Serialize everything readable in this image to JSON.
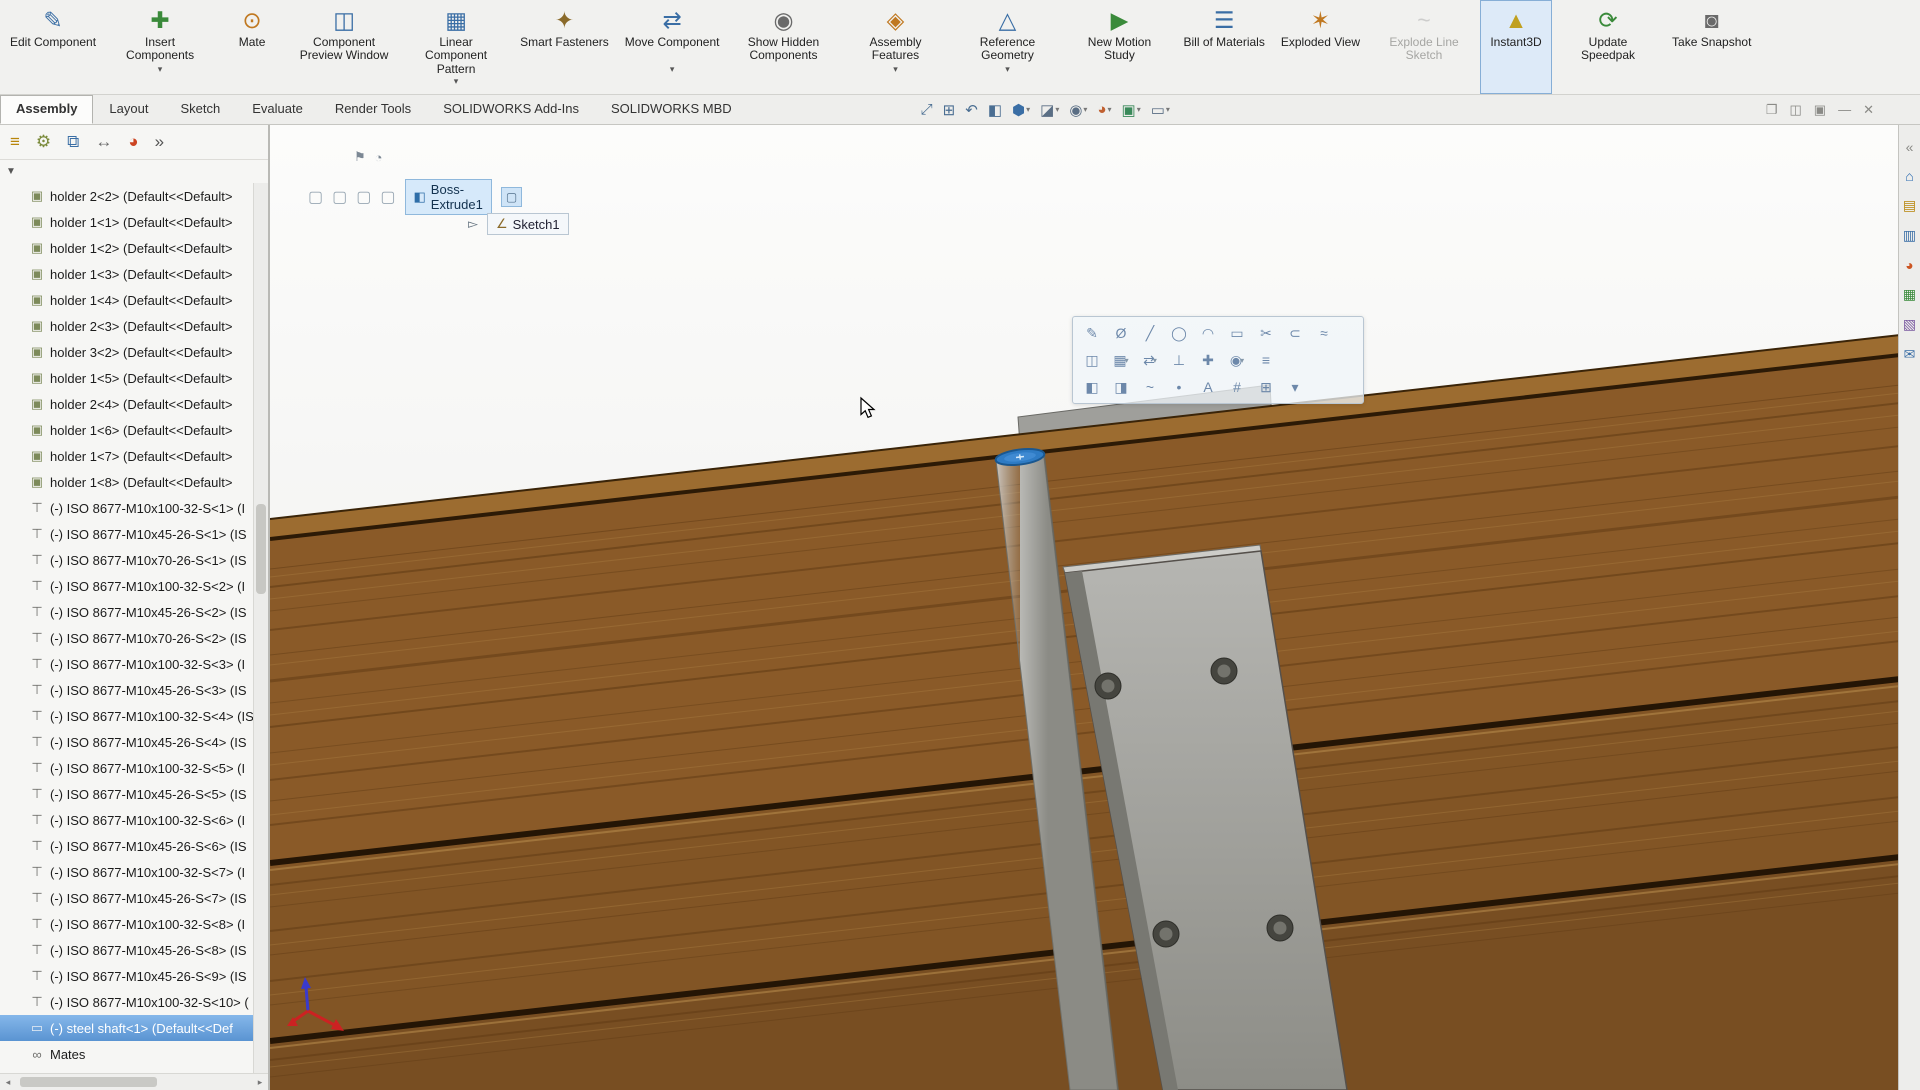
{
  "ribbon": {
    "buttons": [
      {
        "name": "edit-component-button",
        "label": "Edit Component",
        "glyph": "✎",
        "color": "#3a6ea5",
        "dropdown": false,
        "state": ""
      },
      {
        "name": "insert-components-button",
        "label": "Insert Components",
        "glyph": "✚",
        "color": "#3a8a3a",
        "dropdown": true,
        "state": ""
      },
      {
        "name": "mate-button",
        "label": "Mate",
        "glyph": "⊙",
        "color": "#c07820",
        "dropdown": false,
        "state": ""
      },
      {
        "name": "component-preview-window-button",
        "label": "Component Preview Window",
        "glyph": "◫",
        "color": "#3a6ea5",
        "dropdown": false,
        "state": ""
      },
      {
        "name": "linear-component-pattern-button",
        "label": "Linear Component Pattern",
        "glyph": "▦",
        "color": "#3a6ea5",
        "dropdown": true,
        "state": ""
      },
      {
        "name": "smart-fasteners-button",
        "label": "Smart Fasteners",
        "glyph": "✦",
        "color": "#8a6a2a",
        "dropdown": false,
        "state": ""
      },
      {
        "name": "move-component-button",
        "label": "Move Component",
        "glyph": "⇄",
        "color": "#3a6ea5",
        "dropdown": true,
        "state": ""
      },
      {
        "name": "show-hidden-components-button",
        "label": "Show Hidden Components",
        "glyph": "◉",
        "color": "#6a6a6a",
        "dropdown": false,
        "state": ""
      },
      {
        "name": "assembly-features-button",
        "label": "Assembly Features",
        "glyph": "◈",
        "color": "#c07820",
        "dropdown": true,
        "state": ""
      },
      {
        "name": "reference-geometry-button",
        "label": "Reference Geometry",
        "glyph": "△",
        "color": "#3a6ea5",
        "dropdown": true,
        "state": ""
      },
      {
        "name": "new-motion-study-button",
        "label": "New Motion Study",
        "glyph": "▶",
        "color": "#3a8a3a",
        "dropdown": false,
        "state": ""
      },
      {
        "name": "bill-of-materials-button",
        "label": "Bill of Materials",
        "glyph": "☰",
        "color": "#3a6ea5",
        "dropdown": false,
        "state": ""
      },
      {
        "name": "exploded-view-button",
        "label": "Exploded View",
        "glyph": "✶",
        "color": "#c07820",
        "dropdown": false,
        "state": ""
      },
      {
        "name": "explode-line-sketch-button",
        "label": "Explode Line Sketch",
        "glyph": "~",
        "color": "#9a9a9a",
        "dropdown": false,
        "state": "disabled"
      },
      {
        "name": "instant3d-button",
        "label": "Instant3D",
        "glyph": "▲",
        "color": "#c0a020",
        "dropdown": false,
        "state": "active"
      },
      {
        "name": "update-speedpak-button",
        "label": "Update Speedpak",
        "glyph": "⟳",
        "color": "#3a8a3a",
        "dropdown": false,
        "state": ""
      },
      {
        "name": "take-snapshot-button",
        "label": "Take Snapshot",
        "glyph": "◙",
        "color": "#6a6a6a",
        "dropdown": false,
        "state": ""
      }
    ]
  },
  "tabs": {
    "items": [
      {
        "label": "Assembly",
        "state": "active"
      },
      {
        "label": "Layout",
        "state": ""
      },
      {
        "label": "Sketch",
        "state": ""
      },
      {
        "label": "Evaluate",
        "state": ""
      },
      {
        "label": "Render Tools",
        "state": ""
      },
      {
        "label": "SOLIDWORKS Add-Ins",
        "state": ""
      },
      {
        "label": "SOLIDWORKS MBD",
        "state": ""
      }
    ]
  },
  "headsup": {
    "icons": [
      {
        "name": "zoom-to-fit-icon",
        "glyph": "⤢",
        "caret": false,
        "color": "#4a6e92"
      },
      {
        "name": "zoom-to-area-icon",
        "glyph": "⊞",
        "caret": false,
        "color": "#4a6e92"
      },
      {
        "name": "previous-view-icon",
        "glyph": "↶",
        "caret": false,
        "color": "#4a6e92"
      },
      {
        "name": "section-view-icon",
        "glyph": "◧",
        "caret": false,
        "color": "#4a6e92"
      },
      {
        "name": "view-orientation-icon",
        "glyph": "⬢",
        "caret": true,
        "color": "#3a6ea5"
      },
      {
        "name": "display-style-icon",
        "glyph": "◪",
        "caret": true,
        "color": "#5a6e84"
      },
      {
        "name": "hide-show-items-icon",
        "glyph": "◉",
        "caret": true,
        "color": "#5a6e84"
      },
      {
        "name": "edit-appearance-icon",
        "glyph": "◕",
        "caret": true,
        "color": "#c06030"
      },
      {
        "name": "apply-scene-icon",
        "glyph": "▣",
        "caret": true,
        "color": "#3a8a5a"
      },
      {
        "name": "view-settings-icon",
        "glyph": "▭",
        "caret": true,
        "color": "#5a6e84"
      }
    ]
  },
  "window_controls": {
    "icons": [
      {
        "name": "window-cascade-icon",
        "glyph": "❐"
      },
      {
        "name": "window-tile-icon",
        "glyph": "◫"
      },
      {
        "name": "window-restore-icon",
        "glyph": "▣"
      },
      {
        "name": "window-minimize-icon",
        "glyph": "—"
      },
      {
        "name": "window-close-icon",
        "glyph": "✕"
      }
    ]
  },
  "taskpane": {
    "icons": [
      {
        "name": "taskpane-collapse-icon",
        "glyph": "«",
        "color": "#8a8a86"
      },
      {
        "name": "home-icon",
        "glyph": "⌂",
        "color": "#2a6ab0"
      },
      {
        "name": "design-library-icon",
        "glyph": "▤",
        "color": "#b8860b"
      },
      {
        "name": "file-explorer-icon",
        "glyph": "▥",
        "color": "#3a6ea5"
      },
      {
        "name": "appearances-icon",
        "glyph": "◕",
        "color": "#cc5522"
      },
      {
        "name": "scenes-icon",
        "glyph": "▦",
        "color": "#3a8a3a"
      },
      {
        "name": "custom-properties-icon",
        "glyph": "▧",
        "color": "#7a5aa0"
      },
      {
        "name": "forum-icon",
        "glyph": "✉",
        "color": "#3a6ea5"
      }
    ]
  },
  "panel": {
    "tab_icons": [
      {
        "name": "featuremanager-tree-icon",
        "glyph": "≡",
        "color": "#b8860b"
      },
      {
        "name": "propertymanager-icon",
        "glyph": "⚙",
        "color": "#7a8a3a"
      },
      {
        "name": "configurationmanager-icon",
        "glyph": "⧉",
        "color": "#3a6ea5"
      },
      {
        "name": "dimxpertmanager-icon",
        "glyph": "↔",
        "color": "#6a6a6a"
      },
      {
        "name": "displaymanager-icon",
        "glyph": "◕",
        "color": "#cc4422"
      },
      {
        "name": "panel-overflow-chevron-icon",
        "glyph": "»",
        "color": "#555555"
      }
    ],
    "filter_glyph": "▼",
    "tree": {
      "items": [
        {
          "label": "holder 2<2> (Default<<Default>",
          "icon": "component-part-icon",
          "glyph": "▣",
          "type": "part",
          "state": ""
        },
        {
          "label": "holder 1<1> (Default<<Default>",
          "icon": "component-part-icon",
          "glyph": "▣",
          "type": "part",
          "state": ""
        },
        {
          "label": "holder 1<2> (Default<<Default>",
          "icon": "component-part-icon",
          "glyph": "▣",
          "type": "part",
          "state": ""
        },
        {
          "label": "holder 1<3> (Default<<Default>",
          "icon": "component-part-icon",
          "glyph": "▣",
          "type": "part",
          "state": ""
        },
        {
          "label": "holder 1<4> (Default<<Default>",
          "icon": "component-part-icon",
          "glyph": "▣",
          "type": "part",
          "state": ""
        },
        {
          "label": "holder 2<3> (Default<<Default>",
          "icon": "component-part-icon",
          "glyph": "▣",
          "type": "part",
          "state": ""
        },
        {
          "label": "holder 3<2> (Default<<Default>",
          "icon": "component-part-icon",
          "glyph": "▣",
          "type": "part",
          "state": ""
        },
        {
          "label": "holder 1<5> (Default<<Default>",
          "icon": "component-part-icon",
          "glyph": "▣",
          "type": "part",
          "state": ""
        },
        {
          "label": "holder 2<4> (Default<<Default>",
          "icon": "component-part-icon",
          "glyph": "▣",
          "type": "part",
          "state": ""
        },
        {
          "label": "holder 1<6> (Default<<Default>",
          "icon": "component-part-icon",
          "glyph": "▣",
          "type": "part",
          "state": ""
        },
        {
          "label": "holder 1<7> (Default<<Default>",
          "icon": "component-part-icon",
          "glyph": "▣",
          "type": "part",
          "state": ""
        },
        {
          "label": "holder 1<8> (Default<<Default>",
          "icon": "component-part-icon",
          "glyph": "▣",
          "type": "part",
          "state": ""
        },
        {
          "label": "(-) ISO 8677-M10x100-32-S<1> (I",
          "icon": "bolt-icon",
          "glyph": "⊤",
          "type": "bolt",
          "state": ""
        },
        {
          "label": "(-) ISO 8677-M10x45-26-S<1> (IS",
          "icon": "bolt-icon",
          "glyph": "⊤",
          "type": "bolt",
          "state": ""
        },
        {
          "label": "(-) ISO 8677-M10x70-26-S<1> (IS",
          "icon": "bolt-icon",
          "glyph": "⊤",
          "type": "bolt",
          "state": ""
        },
        {
          "label": "(-) ISO 8677-M10x100-32-S<2> (I",
          "icon": "bolt-icon",
          "glyph": "⊤",
          "type": "bolt",
          "state": ""
        },
        {
          "label": "(-) ISO 8677-M10x45-26-S<2> (IS",
          "icon": "bolt-icon",
          "glyph": "⊤",
          "type": "bolt",
          "state": ""
        },
        {
          "label": "(-) ISO 8677-M10x70-26-S<2> (IS",
          "icon": "bolt-icon",
          "glyph": "⊤",
          "type": "bolt",
          "state": ""
        },
        {
          "label": "(-) ISO 8677-M10x100-32-S<3> (I",
          "icon": "bolt-icon",
          "glyph": "⊤",
          "type": "bolt",
          "state": ""
        },
        {
          "label": "(-) ISO 8677-M10x45-26-S<3> (IS",
          "icon": "bolt-icon",
          "glyph": "⊤",
          "type": "bolt",
          "state": ""
        },
        {
          "label": "(-) ISO 8677-M10x100-32-S<4> (IS",
          "icon": "bolt-icon",
          "glyph": "⊤",
          "type": "bolt",
          "state": ""
        },
        {
          "label": "(-) ISO 8677-M10x45-26-S<4> (IS",
          "icon": "bolt-icon",
          "glyph": "⊤",
          "type": "bolt",
          "state": ""
        },
        {
          "label": "(-) ISO 8677-M10x100-32-S<5> (I",
          "icon": "bolt-icon",
          "glyph": "⊤",
          "type": "bolt",
          "state": ""
        },
        {
          "label": "(-) ISO 8677-M10x45-26-S<5> (IS",
          "icon": "bolt-icon",
          "glyph": "⊤",
          "type": "bolt",
          "state": ""
        },
        {
          "label": "(-) ISO 8677-M10x100-32-S<6> (I",
          "icon": "bolt-icon",
          "glyph": "⊤",
          "type": "bolt",
          "state": ""
        },
        {
          "label": "(-) ISO 8677-M10x45-26-S<6> (IS",
          "icon": "bolt-icon",
          "glyph": "⊤",
          "type": "bolt",
          "state": ""
        },
        {
          "label": "(-) ISO 8677-M10x100-32-S<7> (I",
          "icon": "bolt-icon",
          "glyph": "⊤",
          "type": "bolt",
          "state": ""
        },
        {
          "label": "(-) ISO 8677-M10x45-26-S<7> (IS",
          "icon": "bolt-icon",
          "glyph": "⊤",
          "type": "bolt",
          "state": ""
        },
        {
          "label": "(-) ISO 8677-M10x100-32-S<8> (I",
          "icon": "bolt-icon",
          "glyph": "⊤",
          "type": "bolt",
          "state": ""
        },
        {
          "label": "(-) ISO 8677-M10x45-26-S<8> (IS",
          "icon": "bolt-icon",
          "glyph": "⊤",
          "type": "bolt",
          "state": ""
        },
        {
          "label": "(-) ISO 8677-M10x45-26-S<9> (IS",
          "icon": "bolt-icon",
          "glyph": "⊤",
          "type": "bolt",
          "state": ""
        },
        {
          "label": "(-) ISO 8677-M10x100-32-S<10> (",
          "icon": "bolt-icon",
          "glyph": "⊤",
          "type": "bolt",
          "state": ""
        },
        {
          "label": "(-) steel shaft<1> (Default<<Def",
          "icon": "shaft-part-icon",
          "glyph": "▭",
          "type": "shaft",
          "state": "selected"
        },
        {
          "label": "Mates",
          "icon": "mates-folder-icon",
          "glyph": "∞",
          "type": "mates",
          "state": ""
        }
      ]
    }
  },
  "breadcrumb": {
    "top_icons": [
      {
        "name": "breadcrumb-pin-icon",
        "glyph": "⚑"
      },
      {
        "name": "breadcrumb-history-icon",
        "glyph": "◔"
      }
    ],
    "component_glyph": "▢",
    "feature": {
      "glyph": "◧",
      "label": "Boss-Extrude1"
    },
    "feature_suffix_glyph": "▢",
    "pointer_glyph": "▻",
    "sketch": {
      "glyph": "∠",
      "label": "Sketch1"
    }
  },
  "context_toolbar": {
    "row1": [
      {
        "name": "sketch-icon",
        "glyph": "✎",
        "caret": false
      },
      {
        "name": "smart-dimension-icon",
        "glyph": "Ø",
        "caret": false
      },
      {
        "name": "line-icon",
        "glyph": "╱",
        "caret": false
      },
      {
        "name": "circle-icon",
        "glyph": "◯",
        "caret": false
      },
      {
        "name": "arc-icon",
        "glyph": "◠",
        "caret": false
      },
      {
        "name": "rectangle-icon",
        "glyph": "▭",
        "caret": false
      },
      {
        "name": "trim-entities-icon",
        "glyph": "✂",
        "caret": false
      },
      {
        "name": "convert-entities-icon",
        "glyph": "⊂",
        "caret": false
      },
      {
        "name": "offset-entities-icon",
        "glyph": "≈",
        "caret": false
      }
    ],
    "row2": [
      {
        "name": "mirror-entities-icon",
        "glyph": "◫",
        "caret": false
      },
      {
        "name": "linear-sketch-pattern-icon",
        "glyph": "▦",
        "caret": true
      },
      {
        "name": "move-entities-icon",
        "glyph": "⇄",
        "caret": true
      },
      {
        "name": "display-relations-icon",
        "glyph": "⊥",
        "caret": false
      },
      {
        "name": "repair-sketch-icon",
        "glyph": "✚",
        "caret": false
      },
      {
        "name": "quick-snaps-icon",
        "glyph": "◉",
        "caret": true
      },
      {
        "name": "sketch-options-icon",
        "glyph": "≡",
        "caret": false
      }
    ],
    "row3": [
      {
        "name": "plane-icon",
        "glyph": "◧",
        "caret": false
      },
      {
        "name": "3d-sketch-icon",
        "glyph": "◨",
        "caret": false
      },
      {
        "name": "spline-icon",
        "glyph": "~",
        "caret": false
      },
      {
        "name": "point-icon",
        "glyph": "•",
        "caret": false
      },
      {
        "name": "text-icon",
        "glyph": "A",
        "caret": false
      },
      {
        "name": "construction-geometry-icon",
        "glyph": "#",
        "caret": false
      },
      {
        "name": "grid-snap-icon",
        "glyph": "⊞",
        "caret": false
      },
      {
        "name": "more-tools-icon",
        "glyph": "▾",
        "caret": false
      }
    ]
  },
  "viewport": {
    "colors": {
      "background": "#fbfbfa",
      "wood_brown": "#8a5a28",
      "plank_gap": "#241505",
      "metal_gray": "#a8a8a4",
      "selection_blue": "#2e7bc4"
    }
  }
}
